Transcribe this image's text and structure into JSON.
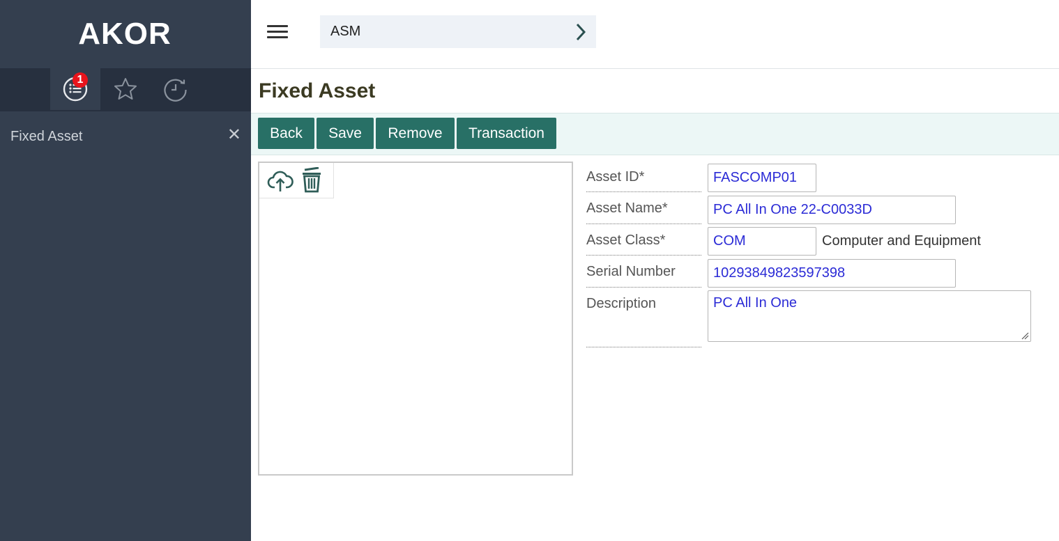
{
  "sidebar": {
    "brand": "AKOR",
    "tabs": [
      {
        "icon": "list-icon",
        "badge": "1",
        "active": true
      },
      {
        "icon": "star-icon",
        "active": false
      },
      {
        "icon": "history-icon",
        "active": false
      }
    ],
    "open_items": [
      {
        "label": "Fixed Asset",
        "close": "✕"
      }
    ]
  },
  "topbar": {
    "module": "ASM"
  },
  "page": {
    "title": "Fixed Asset"
  },
  "toolbar": {
    "back_label": "Back",
    "save_label": "Save",
    "remove_label": "Remove",
    "transaction_label": "Transaction"
  },
  "form": {
    "asset_id": {
      "label": "Asset ID*",
      "value": "FASCOMP01"
    },
    "asset_name": {
      "label": "Asset Name*",
      "value": "PC All In One 22-C0033D"
    },
    "asset_class": {
      "label": "Asset Class*",
      "value": "COM",
      "description": "Computer and Equipment"
    },
    "serial_number": {
      "label": "Serial Number",
      "value": "10293849823597398"
    },
    "description": {
      "label": "Description",
      "value": "PC All In One"
    }
  },
  "colors": {
    "sidebar_bg": "#343f4f",
    "sidebar_tabs_bg": "#27303f",
    "button_bg": "#287066",
    "toolbar_bg": "#ecf7f6",
    "field_text": "#2b2bd6",
    "badge_bg": "#e8141c",
    "title": "#3b3a22"
  }
}
